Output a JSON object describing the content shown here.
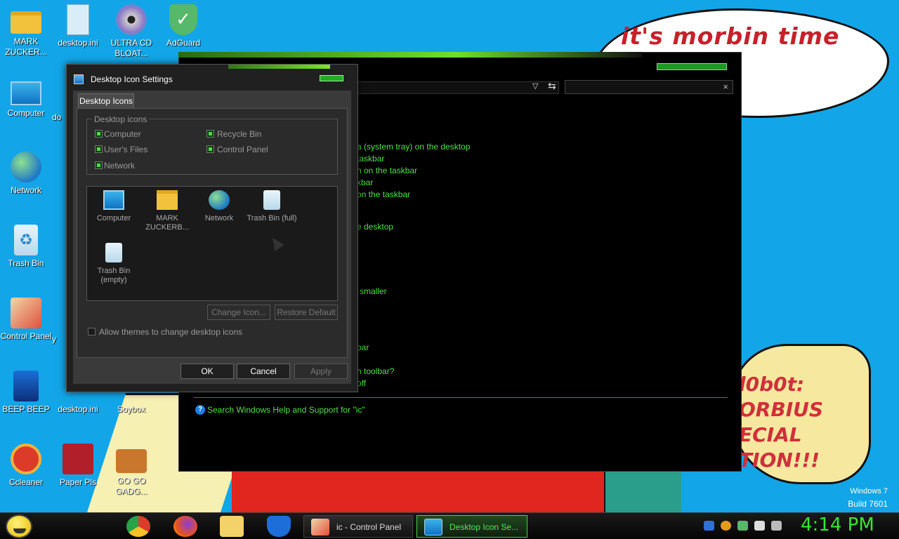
{
  "wallpaper": {
    "bubble_text": "it's morbin  time",
    "caption_lines": [
      "l0b0t:",
      "ORBIUS",
      "ECIAL",
      "TION!!!"
    ],
    "watermark": {
      "line1": "Windows 7",
      "line2": "Build 7601"
    }
  },
  "desktop": {
    "icons": [
      {
        "label": "MARK ZUCKER...",
        "icon": "folder-icon"
      },
      {
        "label": "desktop.ini",
        "icon": "file-icon"
      },
      {
        "label": "ULTRA CD BLOAT...",
        "icon": "cd-icon"
      },
      {
        "label": "AdGuard",
        "icon": "shield-icon"
      },
      {
        "label": "Computer",
        "icon": "computer-icon"
      },
      {
        "label": "do",
        "icon": "file-icon"
      },
      {
        "label": "Network",
        "icon": "network-icon"
      },
      {
        "label": "Trash Bin",
        "icon": "recycle-bin-icon"
      },
      {
        "label": "Control Panel",
        "icon": "control-panel-icon"
      },
      {
        "label": "y",
        "icon": "file-icon"
      },
      {
        "label": "BEEP BEEP",
        "icon": "app-icon"
      },
      {
        "label": "desktop.ini",
        "icon": "file-icon"
      },
      {
        "label": "Soybox",
        "icon": "app-icon"
      },
      {
        "label": "Ccleaner",
        "icon": "ccleaner-icon"
      },
      {
        "label": "Paper Pls",
        "icon": "game-icon"
      },
      {
        "label": "GO GO GADG...",
        "icon": "briefcase-icon"
      }
    ]
  },
  "control_panel": {
    "search_clear": "×",
    "results": [
      "a (system tray) on the desktop",
      "taskbar",
      "n on the taskbar",
      "kbar",
      "on the taskbar",
      "e desktop",
      "smaller",
      "bar",
      "h toolbar?",
      "off"
    ],
    "help_link": "Search Windows Help and Support for \"ic\""
  },
  "dialog": {
    "title": "Desktop Icon Settings",
    "tab": "Desktop Icons",
    "group_label": "Desktop icons",
    "checkboxes": [
      {
        "label": "Computer",
        "checked": true
      },
      {
        "label": "Recycle Bin",
        "checked": true
      },
      {
        "label": "User's Files",
        "checked": true
      },
      {
        "label": "Control Panel",
        "checked": true
      },
      {
        "label": "Network",
        "checked": true
      }
    ],
    "icon_list": [
      {
        "label": "Computer"
      },
      {
        "label": "MARK ZUCKERB..."
      },
      {
        "label": "Network"
      },
      {
        "label": "Trash Bin (full)"
      },
      {
        "label": "Trash Bin (empty)"
      }
    ],
    "change_icon": "Change Icon...",
    "restore_default": "Restore Default",
    "allow_themes": "Allow themes to change desktop icons",
    "ok": "OK",
    "cancel": "Cancel",
    "apply": "Apply"
  },
  "taskbar": {
    "tasks": [
      {
        "label": "ic - Control Panel",
        "active": false
      },
      {
        "label": "Desktop Icon Se...",
        "active": true
      }
    ],
    "clock": "4:14 PM"
  }
}
